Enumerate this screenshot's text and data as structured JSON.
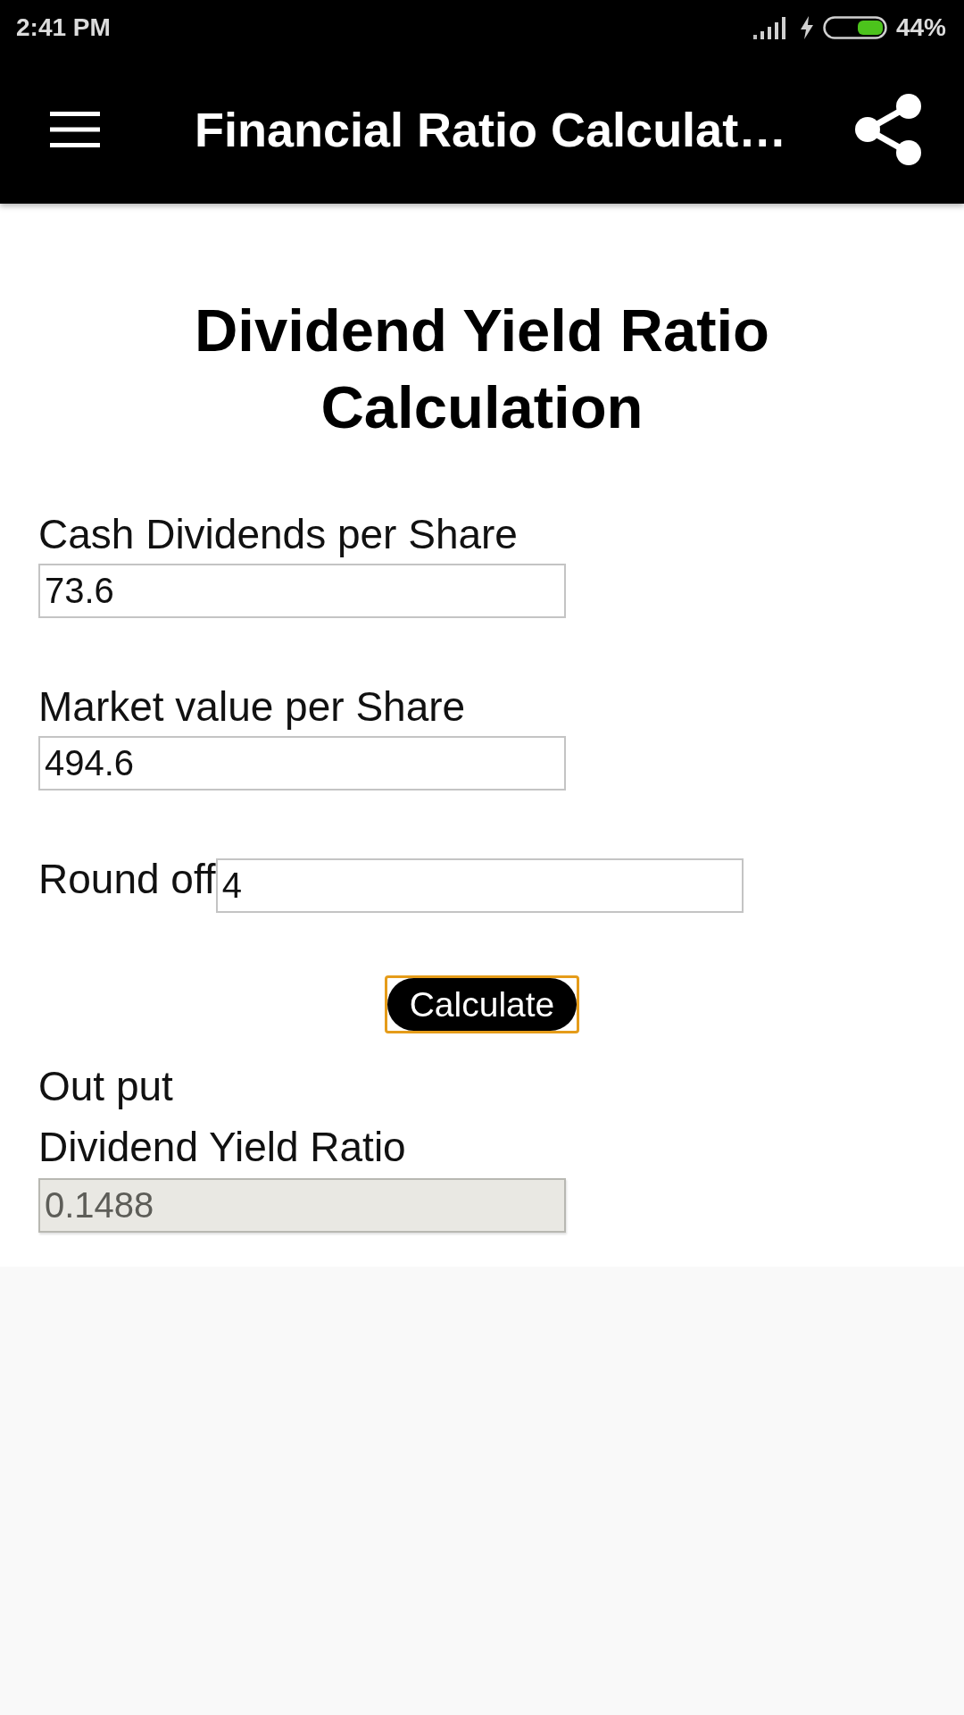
{
  "status_bar": {
    "time": "2:41 PM",
    "battery": "44%"
  },
  "app_bar": {
    "title": "Financial Ratio Calculat…"
  },
  "heading": "Dividend Yield Ratio Calculation",
  "fields": [
    {
      "kind": "stacked",
      "label": "Cash Dividends per Share",
      "value": "73.6"
    },
    {
      "kind": "stacked",
      "label": "Market value per Share",
      "value": "494.6"
    },
    {
      "kind": "inline",
      "label": "Round off",
      "value": "4"
    }
  ],
  "button": {
    "label": "Calculate",
    "focused": true
  },
  "output": {
    "title": "Out put",
    "label": "Dividend Yield Ratio",
    "value": "0.1488",
    "disabled": true
  }
}
